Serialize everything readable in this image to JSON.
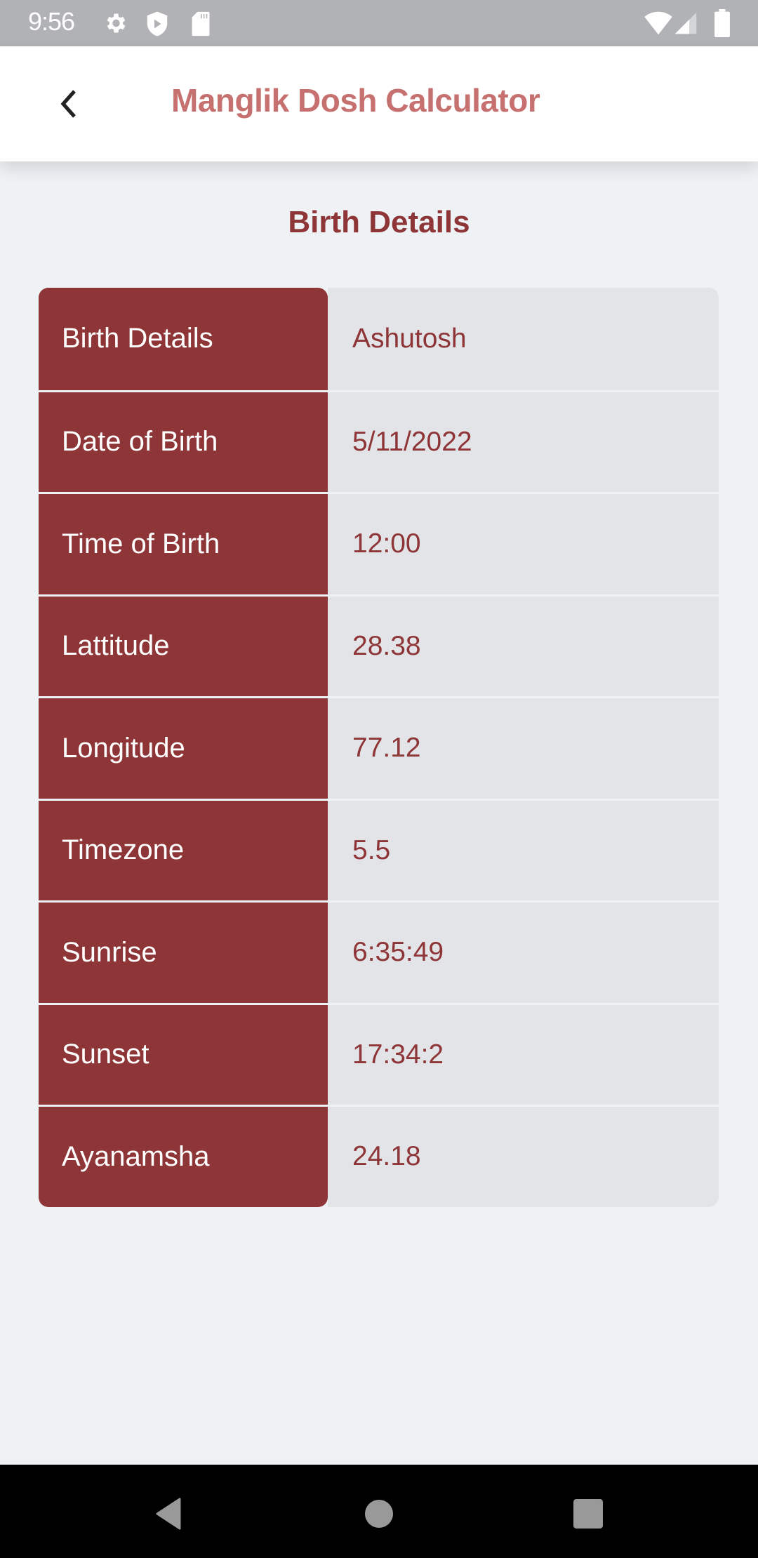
{
  "status_bar": {
    "time": "9:56",
    "left_icons": [
      "gear-icon",
      "shield-play-icon",
      "sd-card-icon"
    ],
    "right_icons": [
      "wifi-icon",
      "cell-signal-icon",
      "battery-icon"
    ]
  },
  "app_bar": {
    "back_icon": "chevron-left-icon",
    "title": "Manglik Dosh Calculator",
    "title_color": "#c6706f"
  },
  "section": {
    "title": "Birth Details",
    "accent_color": "#8e3537"
  },
  "details_table": {
    "rows": [
      {
        "label": "Birth Details",
        "value": "Ashutosh"
      },
      {
        "label": "Date of Birth",
        "value": "5/11/2022"
      },
      {
        "label": "Time of Birth",
        "value": "12:00"
      },
      {
        "label": "Lattitude",
        "value": "28.38"
      },
      {
        "label": "Longitude",
        "value": "77.12"
      },
      {
        "label": "Timezone",
        "value": "5.5"
      },
      {
        "label": "Sunrise",
        "value": "6:35:49"
      },
      {
        "label": "Sunset",
        "value": "17:34:2"
      },
      {
        "label": "Ayanamsha",
        "value": "24.18"
      }
    ]
  },
  "nav_bar": {
    "buttons": [
      "nav-back-icon",
      "nav-home-icon",
      "nav-recents-icon"
    ]
  }
}
